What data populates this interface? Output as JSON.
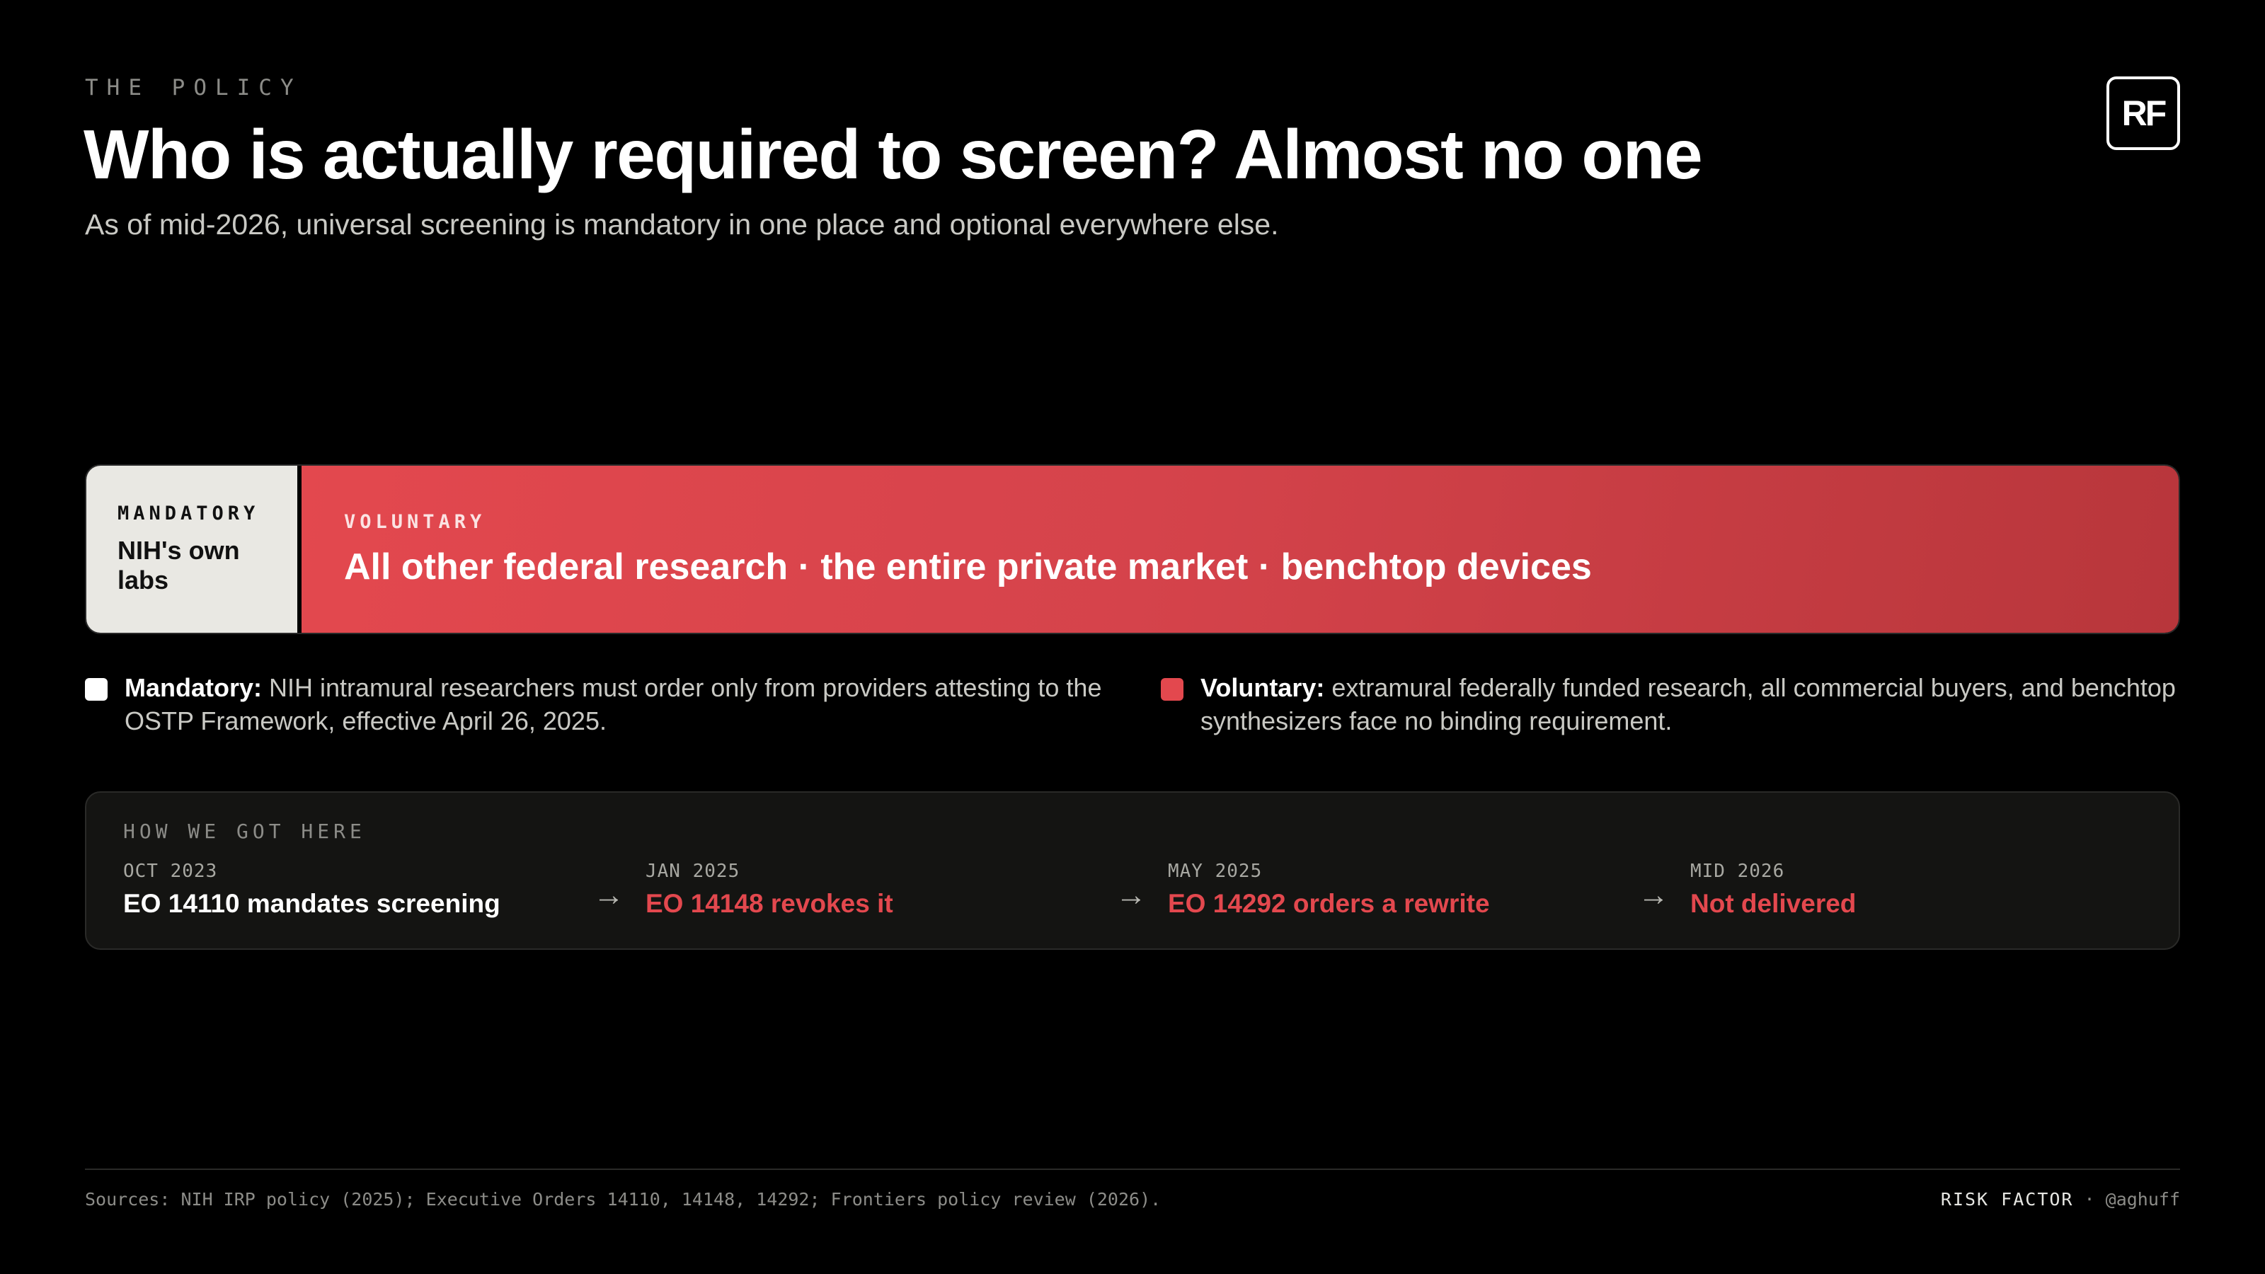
{
  "header": {
    "eyebrow": "THE POLICY",
    "title": "Who is actually required to screen? Almost no one",
    "subtitle": "As of mid-2026, universal screening is mandatory in one place and optional everywhere else.",
    "logo": "RF"
  },
  "split_bar": {
    "mandatory": {
      "label": "MANDATORY",
      "text": "NIH's own labs",
      "color": "#e9e8e3"
    },
    "voluntary": {
      "label": "VOLUNTARY",
      "text": "All other federal research · the entire private market · benchtop devices",
      "color": "#d5434b"
    }
  },
  "legend": [
    {
      "term": "Mandatory:",
      "text": " NIH intramural researchers must order only from providers attesting to the OSTP Framework, effective April 26, 2025.",
      "color": "#ffffff"
    },
    {
      "term": "Voluntary:",
      "text": " extramural federally funded research, all commercial buyers, and benchtop synthesizers face no binding requirement.",
      "color": "#e3484e"
    }
  ],
  "timeline": {
    "heading": "HOW WE GOT HERE",
    "arrow": "→",
    "steps": [
      {
        "date": "OCT 2023",
        "event": "EO 14110 mandates screening",
        "color": "#ffffff"
      },
      {
        "date": "JAN 2025",
        "event": "EO 14148 revokes it",
        "color": "#e3484e"
      },
      {
        "date": "MAY 2025",
        "event": "EO 14292 orders a rewrite",
        "color": "#e3484e"
      },
      {
        "date": "MID 2026",
        "event": "Not delivered",
        "color": "#e3484e"
      }
    ]
  },
  "footer": {
    "sources": "Sources: NIH IRP policy (2025); Executive Orders 14110, 14148, 14292; Frontiers policy review (2026).",
    "brand": "RISK FACTOR",
    "separator": " · ",
    "handle": "@aghuff"
  }
}
